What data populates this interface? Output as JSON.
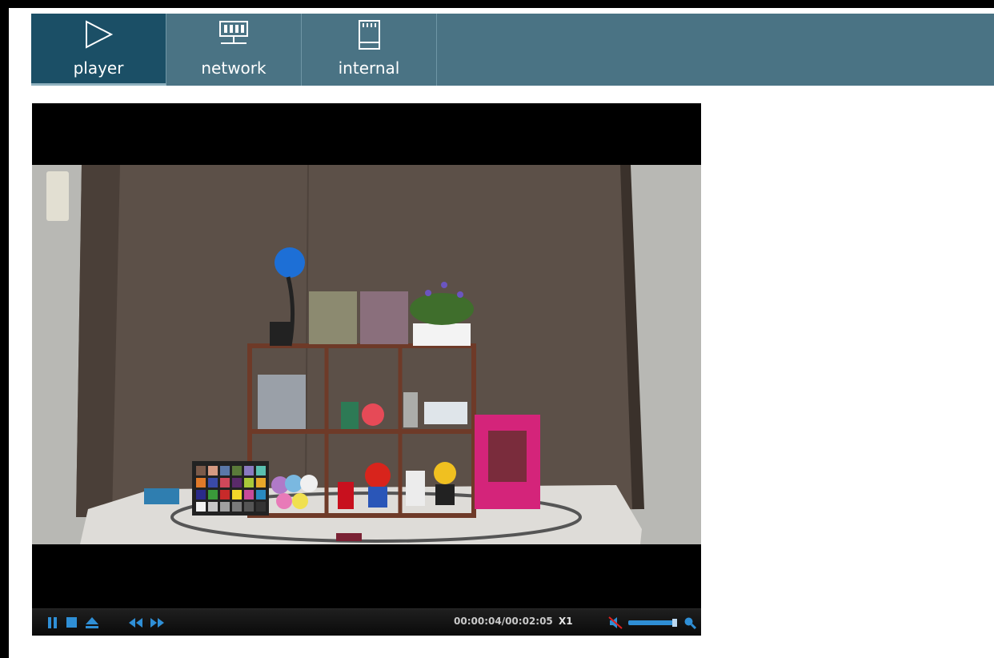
{
  "nav": {
    "tabs": [
      {
        "label": "player",
        "icon": "play-outline-icon",
        "active": true
      },
      {
        "label": "network",
        "icon": "network-icon",
        "active": false
      },
      {
        "label": "internal",
        "icon": "sd-card-icon",
        "active": false
      }
    ],
    "colors": {
      "bar": "#4a7384",
      "active": "#1b4f66"
    }
  },
  "player": {
    "controls": {
      "pause": "pause-icon",
      "stop": "stop-icon",
      "eject": "eject-icon",
      "rewind": "rewind-icon",
      "fast_forward": "fast-forward-icon",
      "timecode": "00:00:04/00:02:05",
      "speed": "X1",
      "mute": "mute-icon",
      "volume": "volume-slider",
      "zoom": "zoom-icon"
    },
    "accent": "#2f8fd6"
  }
}
